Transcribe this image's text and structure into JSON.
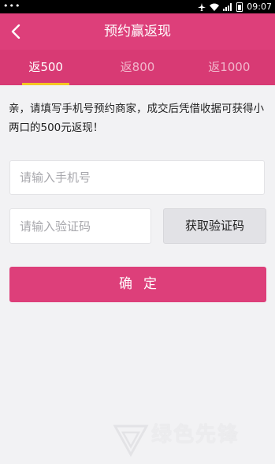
{
  "status_bar": {
    "time": "09:07",
    "dots": "•••"
  },
  "header": {
    "title": "预约赢返现",
    "back_icon": "chevron-left-icon"
  },
  "tabs": [
    {
      "label": "返500",
      "active": true
    },
    {
      "label": "返800",
      "active": false
    },
    {
      "label": "返1000",
      "active": false
    }
  ],
  "notice": "亲，请填写手机号预约商家，成交后凭借收据可获得小两口的500元返现！",
  "form": {
    "phone_placeholder": "请输入手机号",
    "code_placeholder": "请输入验证码",
    "get_code_label": "获取验证码",
    "confirm_label": "确定"
  },
  "colors": {
    "brand": "#dd3f7a",
    "tab_indicator": "#f5c623",
    "background": "#f2f2f4"
  },
  "watermark": {
    "text": "绿色先锋"
  }
}
